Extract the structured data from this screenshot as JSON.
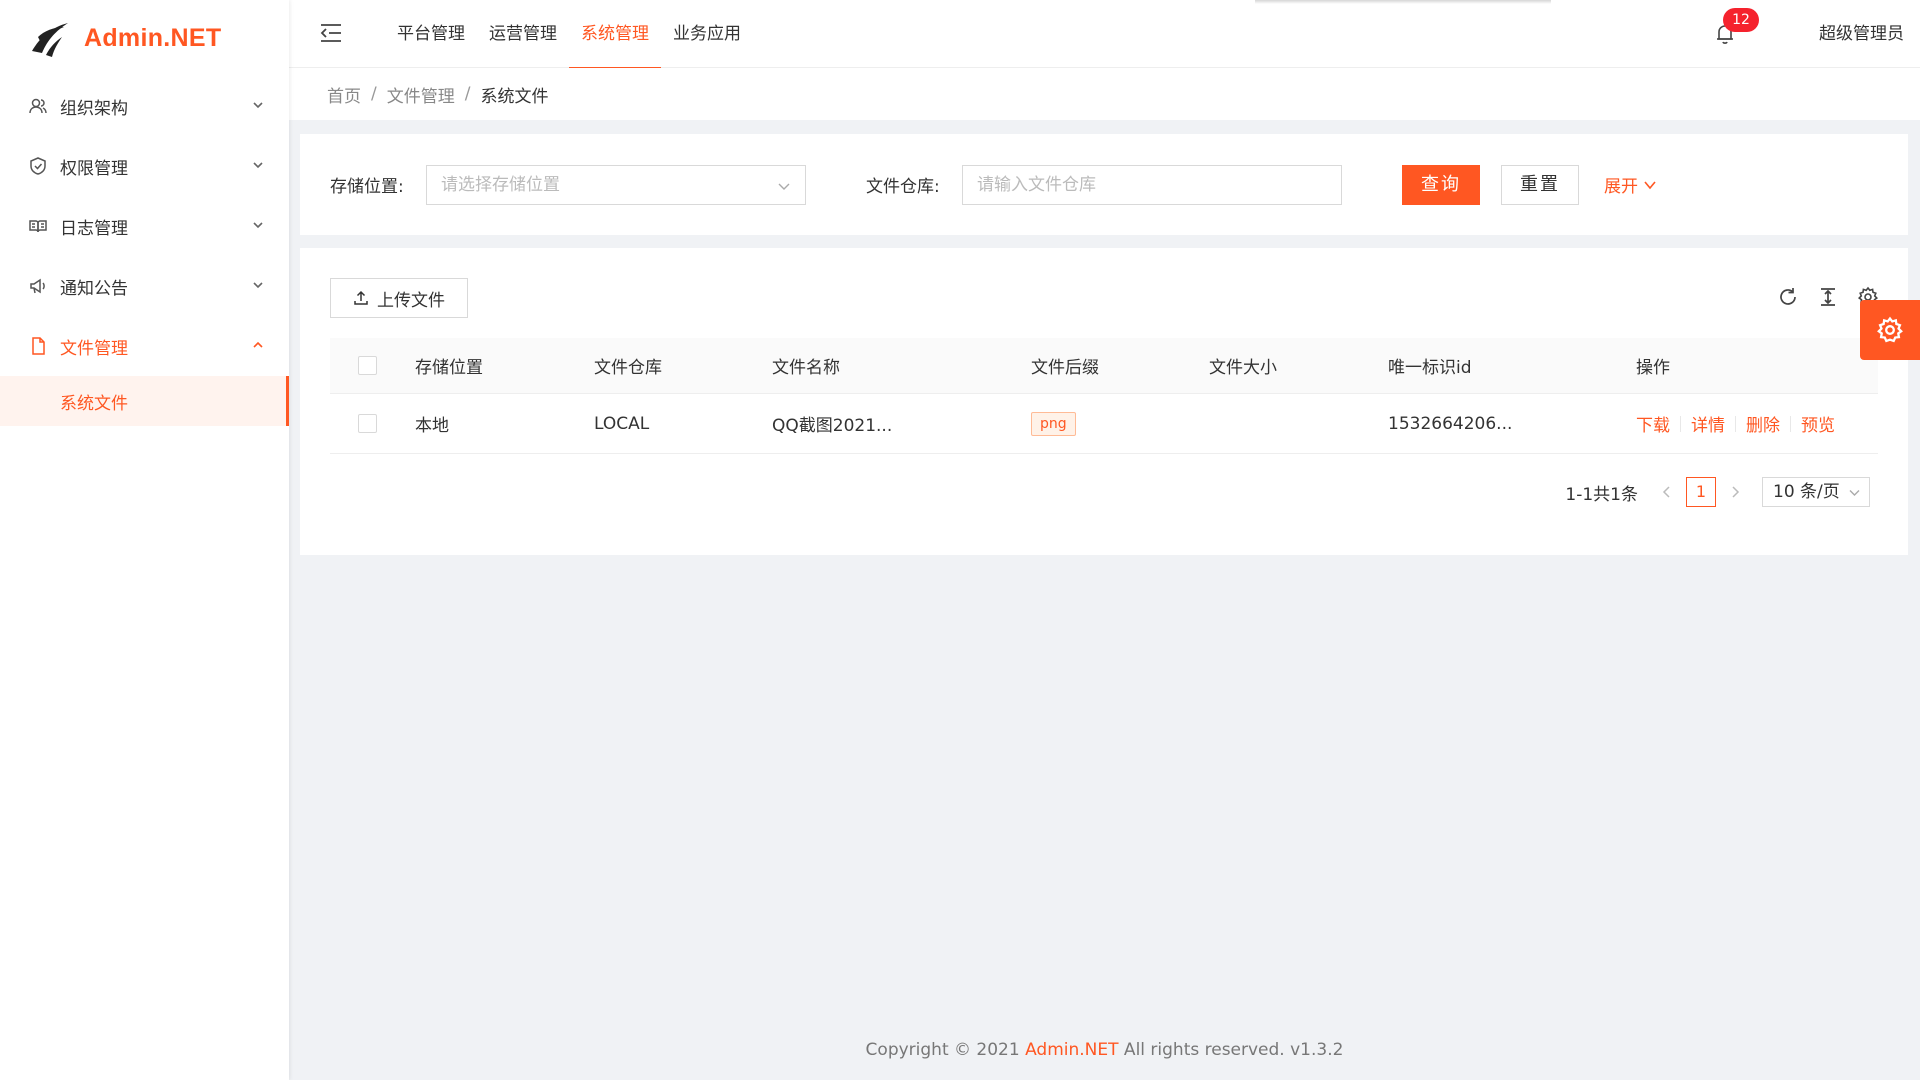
{
  "brand": {
    "name": "Admin.NET",
    "color": "#ff5722"
  },
  "sidebar": {
    "groups": [
      {
        "label": "组织架构",
        "icon": "user-group-icon"
      },
      {
        "label": "权限管理",
        "icon": "shield-icon"
      },
      {
        "label": "日志管理",
        "icon": "book-icon"
      },
      {
        "label": "通知公告",
        "icon": "megaphone-icon"
      },
      {
        "label": "文件管理",
        "icon": "file-icon",
        "active": true
      }
    ],
    "active_sub": "系统文件"
  },
  "header": {
    "nav": [
      {
        "label": "平台管理"
      },
      {
        "label": "运营管理"
      },
      {
        "label": "系统管理",
        "active": true
      },
      {
        "label": "业务应用"
      }
    ],
    "notification_count": "12",
    "user": "超级管理员"
  },
  "breadcrumb": {
    "home": "首页",
    "parent": "文件管理",
    "current": "系统文件",
    "sep": "/"
  },
  "search": {
    "storage_label": "存储位置:",
    "storage_placeholder": "请选择存储位置",
    "bucket_label": "文件仓库:",
    "bucket_placeholder": "请输入文件仓库",
    "query": "查询",
    "reset": "重置",
    "expand": "展开"
  },
  "table": {
    "upload": "上传文件",
    "columns": [
      "存储位置",
      "文件仓库",
      "文件名称",
      "文件后缀",
      "文件大小",
      "唯一标识id",
      "操作"
    ],
    "rows": [
      {
        "location": "本地",
        "bucket": "LOCAL",
        "name": "QQ截图2021...",
        "suffix": "png",
        "size": "",
        "id": "1532664206...",
        "actions": [
          "下载",
          "详情",
          "删除",
          "预览"
        ]
      }
    ],
    "pagination": {
      "total": "1-1共1条",
      "page": "1",
      "size": "10 条/页"
    }
  },
  "footer": {
    "prefix": "Copyright © 2021 ",
    "brand": "Admin.NET",
    "suffix": " All rights reserved. v1.3.2"
  }
}
